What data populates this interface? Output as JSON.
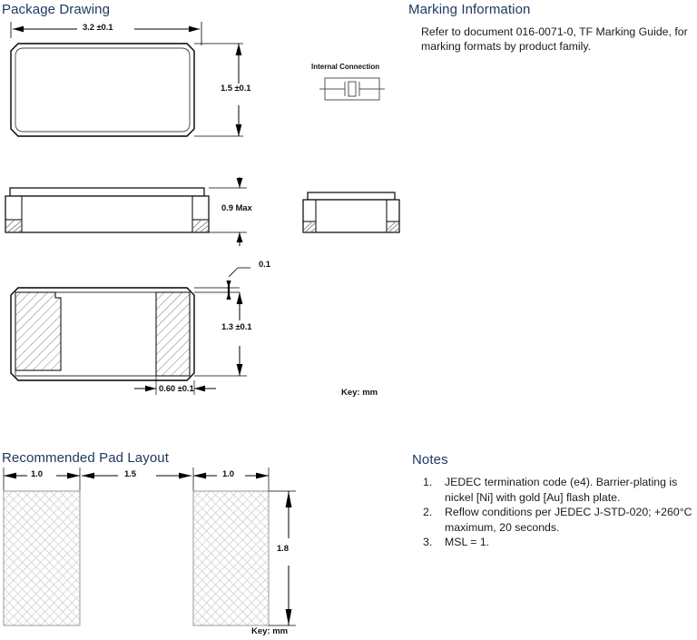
{
  "sections": {
    "package_drawing": {
      "title": "Package Drawing",
      "key": "Key:  mm",
      "internal_connection_title": "Internal Connection",
      "dimensions": {
        "length": "3.2 ±0.1",
        "width": "1.5 ±0.1",
        "height": "0.9 Max",
        "pad_gap": "0.1",
        "pad_width": "1.3 ±0.1",
        "pad_length": "0.60 ±0.1"
      }
    },
    "marking_information": {
      "title": "Marking Information",
      "body_line1": "Refer to document 016-0071-0, TF Marking Guide, for",
      "body_line2": "marking formats by product family."
    },
    "recommended_pad_layout": {
      "title": "Recommended Pad Layout",
      "key": "Key:  mm",
      "dimensions": {
        "pad1_width": "1.0",
        "gap": "1.5",
        "pad2_width": "1.0",
        "pad_height": "1.8"
      }
    },
    "notes": {
      "title": "Notes",
      "items": [
        {
          "num": "1.",
          "line1": "JEDEC termination code (e4).  Barrier-plating is",
          "line2": "nickel [Ni] with gold [Au] flash plate."
        },
        {
          "num": "2.",
          "line1": "Reflow conditions per JEDEC J-STD-020; +260°C",
          "line2": "maximum, 20 seconds."
        },
        {
          "num": "3.",
          "line1": "MSL = 1.",
          "line2": ""
        }
      ]
    }
  },
  "colors": {
    "heading": "#1f3864",
    "line": "#000000",
    "hatch": "#8c8c8c",
    "body_text": "#1a1a1a"
  }
}
